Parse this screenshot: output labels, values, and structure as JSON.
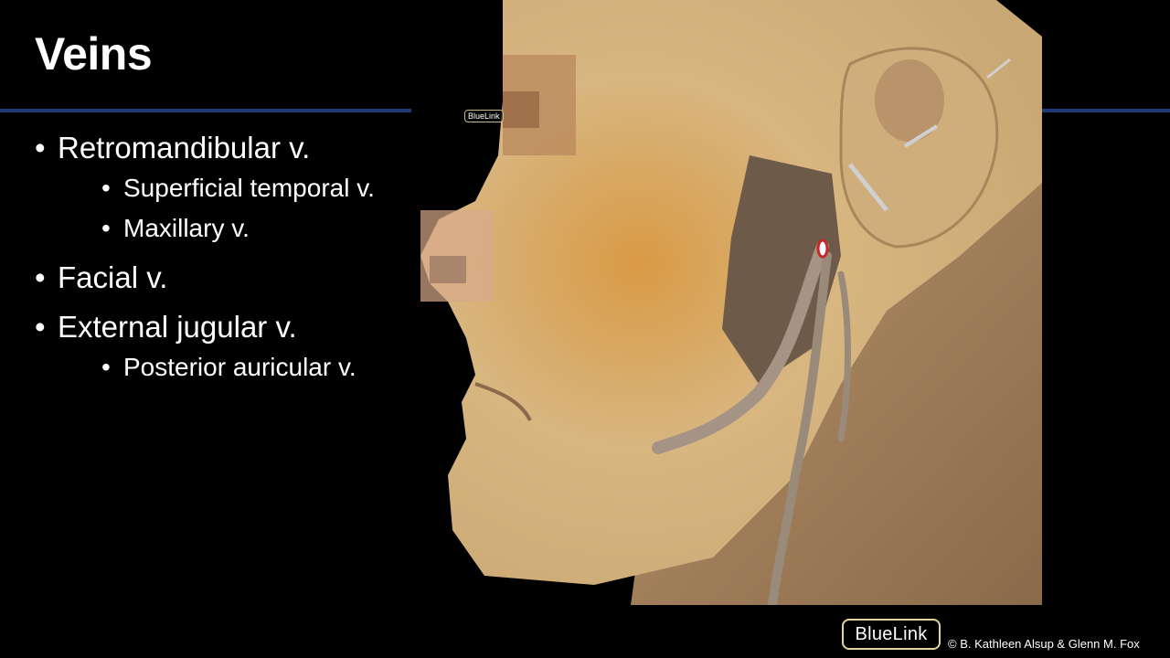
{
  "slide": {
    "title": "Veins",
    "bullets": [
      {
        "label": "Retromandibular v.",
        "sub": [
          "Superficial temporal v.",
          "Maxillary v."
        ]
      },
      {
        "label": "Facial v.",
        "sub": []
      },
      {
        "label": "External jugular v.",
        "sub": [
          "Posterior auricular v."
        ]
      }
    ]
  },
  "watermark": {
    "small_logo": "BlueLink",
    "logo": "BlueLink",
    "copyright": "© B. Kathleen Alsup & Glenn M. Fox"
  },
  "colors": {
    "background": "#000000",
    "rule": "#1f3a7a",
    "logo_border": "#e5d59a",
    "text": "#ffffff"
  }
}
